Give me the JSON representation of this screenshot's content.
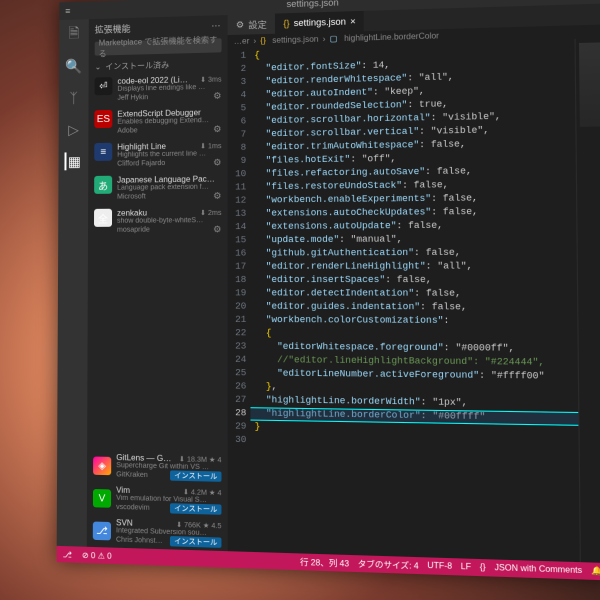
{
  "window": {
    "title": "settings.json"
  },
  "sidebar": {
    "title": "拡張機能",
    "search_placeholder": "Marketplace で拡張機能を検索する",
    "section_installed": "インストール済み",
    "installed": [
      {
        "name": "code-eol 2022 (Li…",
        "desc": "Displays line endings like …",
        "publisher": "Jeff Hykin",
        "meta": "⬇ 3ms"
      },
      {
        "name": "ExtendScript Debugger",
        "desc": "Enables debugging Extend…",
        "publisher": "Adobe",
        "meta": ""
      },
      {
        "name": "Highlight Line",
        "desc": "Highlights the current line …",
        "publisher": "Clifford Fajardo",
        "meta": "⬇ 1ms"
      },
      {
        "name": "Japanese Language Pac…",
        "desc": "Language pack extension f…",
        "publisher": "Microsoft",
        "meta": ""
      },
      {
        "name": "zenkaku",
        "desc": "show double-byte-whiteS…",
        "publisher": "mosapride",
        "meta": "⬇ 2ms"
      }
    ],
    "recommended": [
      {
        "name": "GitLens — G…",
        "desc": "Supercharge Git within VS …",
        "publisher": "GitKraken",
        "meta": "⬇ 18.3M ★ 4",
        "install": "インストール"
      },
      {
        "name": "Vim",
        "desc": "Vim emulation for Visual S…",
        "publisher": "vscodevim",
        "meta": "⬇ 4.2M ★ 4",
        "install": "インストール"
      },
      {
        "name": "SVN",
        "desc": "Integrated Subversion sou…",
        "publisher": "Chris Johnst…",
        "meta": "⬇ 766K ★ 4.5",
        "install": "インストール"
      }
    ]
  },
  "tabs": {
    "settings": "設定",
    "file": "settings.json"
  },
  "breadcrumb": {
    "b1": "…er",
    "b2": "settings.json",
    "b3": "highlightLine.borderColor"
  },
  "code": {
    "active_line": 28,
    "lines": [
      "{",
      "  \"editor.fontSize\": 14,",
      "  \"editor.renderWhitespace\": \"all\",",
      "  \"editor.autoIndent\": \"keep\",",
      "  \"editor.roundedSelection\": true,",
      "  \"editor.scrollbar.horizontal\": \"visible\",",
      "  \"editor.scrollbar.vertical\": \"visible\",",
      "  \"editor.trimAutoWhitespace\": false,",
      "  \"files.hotExit\": \"off\",",
      "  \"files.refactoring.autoSave\": false,",
      "  \"files.restoreUndoStack\": false,",
      "  \"workbench.enableExperiments\": false,",
      "  \"extensions.autoCheckUpdates\": false,",
      "  \"extensions.autoUpdate\": false,",
      "  \"update.mode\": \"manual\",",
      "  \"github.gitAuthentication\": false,",
      "  \"editor.renderLineHighlight\": \"all\",",
      "  \"editor.insertSpaces\": false,",
      "  \"editor.detectIndentation\": false,",
      "  \"editor.guides.indentation\": false,",
      "  \"workbench.colorCustomizations\":",
      "  {",
      "    \"editorWhitespace.foreground\": \"#0000ff\",",
      "    //\"editor.lineHighlightBackground\": \"#224444\",",
      "    \"editorLineNumber.activeForeground\": \"#ffff00\"",
      "  },",
      "  \"highlightLine.borderWidth\": \"1px\",",
      "  \"highlightLine.borderColor\": \"#00ffff\"",
      "}",
      ""
    ]
  },
  "status": {
    "pos": "行 28、列 43",
    "tab": "タブのサイズ: 4",
    "enc": "UTF-8",
    "eol": "LF",
    "lang": "JSON with Comments",
    "bell": "🔔"
  },
  "icons": {
    "gear": "⚙",
    "close": "×",
    "chevron": "›",
    "chevron_down": "⌄",
    "braces": "{}",
    "dots": "⋯"
  }
}
